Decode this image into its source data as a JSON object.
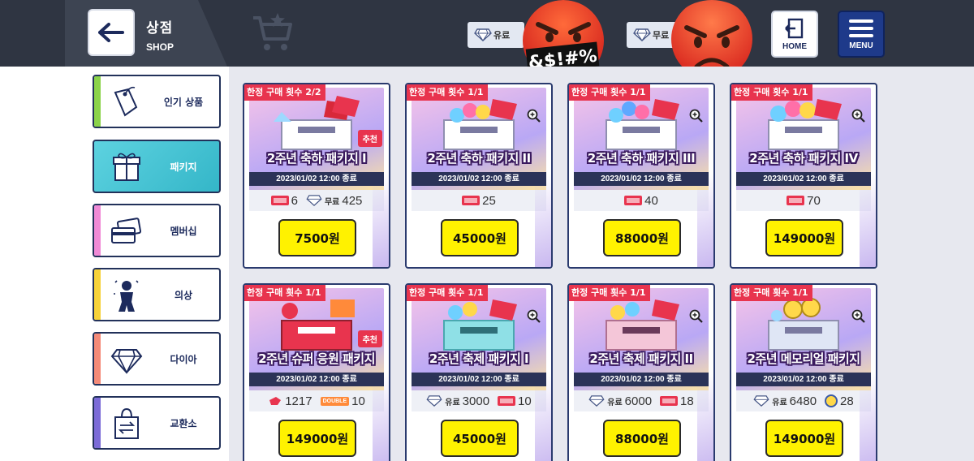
{
  "header": {
    "title_ko": "상점",
    "title_en": "SHOP",
    "back_icon": "arrow-left-icon",
    "paid_label": "유료",
    "free_label": "무료",
    "censor_text": "&$!#%",
    "home_label": "HOME",
    "menu_label": "MENU"
  },
  "sidebar": {
    "items": [
      {
        "label": "인기 상품",
        "icon": "price-tag-icon",
        "stripe": "#8bd34a",
        "active": false
      },
      {
        "label": "패키지",
        "icon": "gift-box-icon",
        "stripe": "#5dd2e0",
        "active": true
      },
      {
        "label": "멤버십",
        "icon": "membership-card-icon",
        "stripe": "#f08ad6",
        "active": false
      },
      {
        "label": "의상",
        "icon": "costume-icon",
        "stripe": "#f6d23a",
        "active": false
      },
      {
        "label": "다이아",
        "icon": "diamond-icon",
        "stripe": "#f48a78",
        "active": false
      },
      {
        "label": "교환소",
        "icon": "exchange-bag-icon",
        "stripe": "#7b6bd8",
        "active": false
      }
    ]
  },
  "products": [
    {
      "limit": "한정 구매 횟수 2/2",
      "name": "2주년 축하 패키지 I",
      "date": "2023/01/02 12:00 종료",
      "reco": "추천",
      "zoom": false,
      "items": [
        {
          "icon": "ticket-icon",
          "qty": "6"
        },
        {
          "icon": "diamond-free-icon",
          "label": "무료",
          "qty": "425"
        }
      ],
      "price": "7500원"
    },
    {
      "limit": "한정 구매 횟수 1/1",
      "name": "2주년 축하 패키지 II",
      "date": "2023/01/02 12:00 종료",
      "reco": "",
      "zoom": true,
      "items": [
        {
          "icon": "ticket-icon",
          "qty": "25"
        }
      ],
      "price": "45000원"
    },
    {
      "limit": "한정 구매 횟수 1/1",
      "name": "2주년 축하 패키지 III",
      "date": "2023/01/02 12:00 종료",
      "reco": "",
      "zoom": true,
      "items": [
        {
          "icon": "ticket-icon",
          "qty": "40"
        }
      ],
      "price": "88000원"
    },
    {
      "limit": "한정 구매 횟수 1/1",
      "name": "2주년 축하 패키지 IV",
      "date": "2023/01/02 12:00 종료",
      "reco": "",
      "zoom": true,
      "items": [
        {
          "icon": "ticket-icon",
          "qty": "70"
        }
      ],
      "price": "149000원"
    },
    {
      "limit": "한정 구매 횟수 1/1",
      "name": "2주년 슈퍼 응원 패키지",
      "date": "2023/01/02 12:00 종료",
      "reco": "추천",
      "zoom": false,
      "items": [
        {
          "icon": "whistle-icon",
          "qty": "1217"
        },
        {
          "icon": "double-ticket-icon",
          "label": "DOUBLE",
          "qty": "10"
        }
      ],
      "price": "149000원"
    },
    {
      "limit": "한정 구매 횟수 1/1",
      "name": "2주년 축제 패키지 I",
      "date": "2023/01/02 12:00 종료",
      "reco": "",
      "zoom": true,
      "items": [
        {
          "icon": "diamond-paid-icon",
          "label": "유료",
          "qty": "3000"
        },
        {
          "icon": "ticket-icon",
          "qty": "10"
        }
      ],
      "price": "45000원"
    },
    {
      "limit": "한정 구매 횟수 1/1",
      "name": "2주년 축제 패키지 II",
      "date": "2023/01/02 12:00 종료",
      "reco": "",
      "zoom": true,
      "items": [
        {
          "icon": "diamond-paid-icon",
          "label": "유료",
          "qty": "6000"
        },
        {
          "icon": "ticket-icon",
          "qty": "18"
        }
      ],
      "price": "88000원"
    },
    {
      "limit": "한정 구매 횟수 1/1",
      "name": "2주년 메모리얼 패키지",
      "date": "2023/01/02 12:00 종료",
      "reco": "",
      "zoom": true,
      "items": [
        {
          "icon": "diamond-paid-icon",
          "label": "유료",
          "qty": "6480"
        },
        {
          "icon": "coin-icon",
          "qty": "28"
        }
      ],
      "price": "149000원"
    }
  ]
}
